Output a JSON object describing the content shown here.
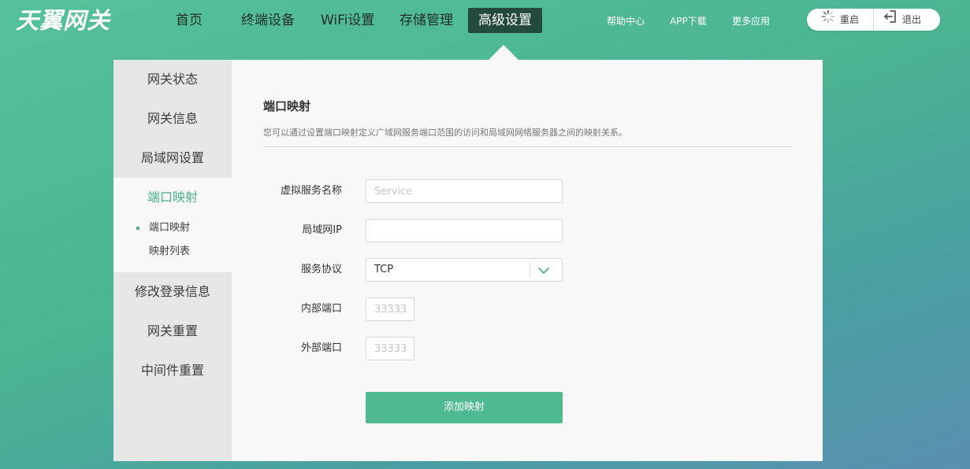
{
  "brand": {
    "logo_text": "天翼网关"
  },
  "nav": {
    "items": [
      {
        "label": "首页"
      },
      {
        "label": "终端设备"
      },
      {
        "label": "WiFi设置"
      },
      {
        "label": "存储管理"
      },
      {
        "label": "高级设置",
        "active": true
      }
    ]
  },
  "top_links": {
    "help": "帮助中心",
    "app": "APP下载",
    "more": "更多应用"
  },
  "actions": {
    "restart_label": "重启",
    "logout_label": "退出",
    "restart_icon": "spinner-icon",
    "logout_icon": "logout-icon"
  },
  "sidebar": {
    "items": [
      {
        "label": "网关状态"
      },
      {
        "label": "网关信息"
      },
      {
        "label": "局域网设置"
      },
      {
        "label": "端口映射",
        "active": true
      },
      {
        "label": "修改登录信息"
      },
      {
        "label": "网关重置"
      },
      {
        "label": "中间件重置"
      }
    ],
    "sub_items": [
      {
        "label": "端口映射",
        "active": true
      },
      {
        "label": "映射列表"
      }
    ]
  },
  "content": {
    "title": "端口映射",
    "description": "您可以通过设置端口映射定义广域网服务端口范围的访问和局域网网络服务器之间的映射关系。"
  },
  "form": {
    "service_name": {
      "label": "虚拟服务名称",
      "placeholder": "Service",
      "value": ""
    },
    "lan_ip": {
      "label": "局域网IP",
      "placeholder": "",
      "value": ""
    },
    "protocol": {
      "label": "服务协议",
      "value": "TCP"
    },
    "internal_port": {
      "label": "内部端口",
      "placeholder": "33333",
      "value": ""
    },
    "external_port": {
      "label": "外部端口",
      "placeholder": "33333",
      "value": ""
    },
    "submit_label": "添加映射"
  },
  "colors": {
    "accent": "#4fba8f",
    "active_nav_bg": "#234a3d",
    "active_text": "#4cb08c"
  }
}
